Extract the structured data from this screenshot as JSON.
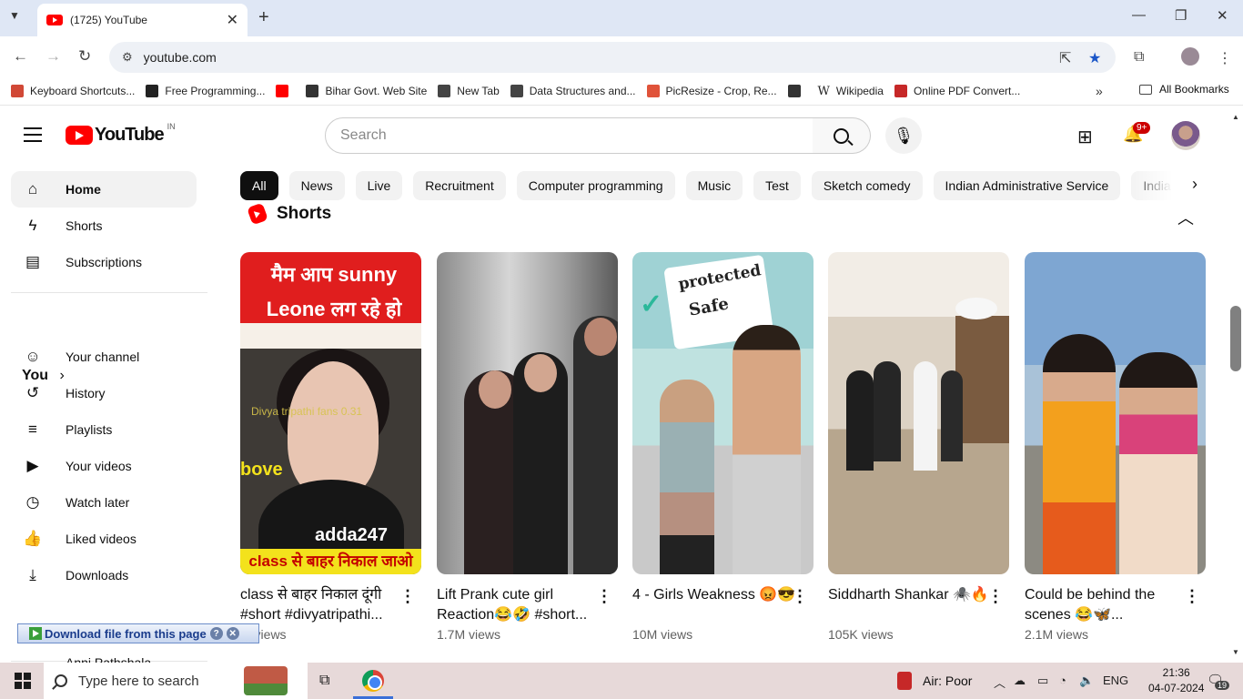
{
  "browser": {
    "tab_title": "(1725) YouTube",
    "url": "youtube.com",
    "bookmarks": [
      {
        "label": "Keyboard Shortcuts...",
        "color": "#d14836"
      },
      {
        "label": "Free Programming...",
        "color": "#222222"
      },
      {
        "label": "",
        "color": "#ff0000"
      },
      {
        "label": "Bihar Govt. Web Site",
        "color": "#333333"
      },
      {
        "label": "New Tab",
        "color": "#444444"
      },
      {
        "label": "Data Structures and...",
        "color": "#444444"
      },
      {
        "label": "PicResize - Crop, Re...",
        "color": "#e0533a"
      },
      {
        "label": "",
        "color": "#333333"
      },
      {
        "label": "Wikipedia",
        "color": "#ffffff"
      },
      {
        "label": "Online PDF Convert...",
        "color": "#c62828"
      }
    ],
    "all_bookmarks": "All Bookmarks"
  },
  "youtube": {
    "logo_text": "YouTube",
    "country": "IN",
    "search_placeholder": "Search",
    "notification_count": "9+",
    "sidebar": {
      "top": [
        {
          "label": "Home",
          "icon": "home-icon"
        },
        {
          "label": "Shorts",
          "icon": "shorts-icon"
        },
        {
          "label": "Subscriptions",
          "icon": "subscriptions-icon"
        }
      ],
      "you_label": "You",
      "you": [
        {
          "label": "Your channel",
          "icon": "channel-icon"
        },
        {
          "label": "History",
          "icon": "history-icon"
        },
        {
          "label": "Playlists",
          "icon": "playlists-icon"
        },
        {
          "label": "Your videos",
          "icon": "videos-icon"
        },
        {
          "label": "Watch later",
          "icon": "clock-icon"
        },
        {
          "label": "Liked videos",
          "icon": "thumb-up-icon"
        },
        {
          "label": "Downloads",
          "icon": "download-icon"
        }
      ],
      "partial_item": "Anni Pathshala"
    },
    "chips": [
      "All",
      "News",
      "Live",
      "Recruitment",
      "Computer programming",
      "Music",
      "Test",
      "Sketch comedy",
      "Indian Administrative Service",
      "India"
    ],
    "shorts_heading": "Shorts",
    "shorts": [
      {
        "title": "class से बाहर निकाल दूंगी #short #divyatripathi...",
        "views": "M views",
        "thumb_top": "मैम आप sunny Leone लग रहे हो",
        "thumb_bottom": "class से बाहर निकाल जाओ",
        "thumb_side": "bove",
        "thumb_brand": "adda247",
        "thumb_watermark": "Divya tripathi fans  0.31"
      },
      {
        "title": "Lift Prank cute girl Reaction😂🤣 #short...",
        "views": "1.7M views"
      },
      {
        "title": "4 - Girls Weakness 😡😎",
        "views": "10M views",
        "thumb_word1": "protected",
        "thumb_word2": "Safe"
      },
      {
        "title": "Siddharth Shankar 🕷️🔥",
        "views": "105K views"
      },
      {
        "title": "Could be behind the scenes 😂🦋...",
        "views": "2.1M views"
      }
    ]
  },
  "extension_bar": {
    "label": "Download file from this page"
  },
  "taskbar": {
    "search_placeholder": "Type here to search",
    "air_quality": "Air: Poor",
    "language": "ENG",
    "time": "21:36",
    "date": "04-07-2024",
    "notification_count": "19"
  }
}
